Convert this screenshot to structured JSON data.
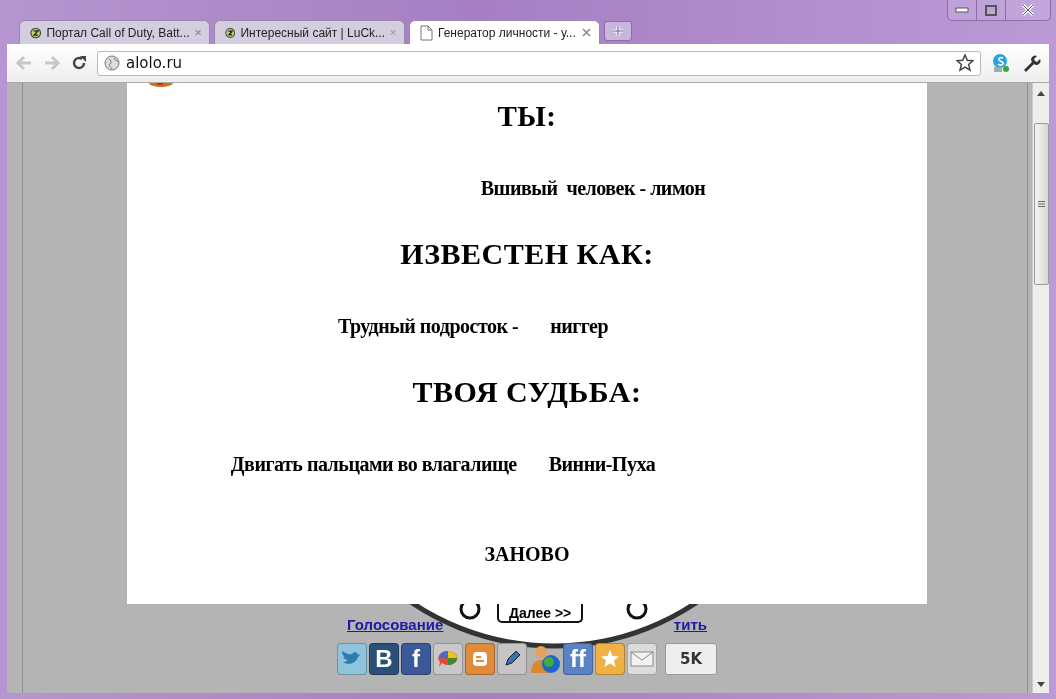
{
  "tabs": [
    {
      "title": "Портал Call of Duty, Batt...",
      "selected": false
    },
    {
      "title": "Интересный сайт | LuCk...",
      "selected": false
    },
    {
      "title": "Генератор личности - у...",
      "selected": true
    }
  ],
  "toolbar": {
    "back_disabled": true,
    "forward_disabled": true,
    "address": "alolo.ru"
  },
  "generator": {
    "sections": [
      {
        "heading": "ТЫ:",
        "parts": [
          "Вшивый  человек - лимон"
        ]
      },
      {
        "heading": "ИЗВЕСТЕН КАК:",
        "parts": [
          "Трудный подросток -",
          "ниггер"
        ]
      },
      {
        "heading": "ТВОЯ СУДЬБА:",
        "parts": [
          "Двигать пальцами во влагалище",
          "Винни-Пуха"
        ]
      }
    ],
    "restart": "ЗАНОВО"
  },
  "behind": {
    "next_button": "Далее >>",
    "link_left": "Голосование",
    "link_right": "тить"
  },
  "share": {
    "buttons": [
      {
        "kind": "twitter"
      },
      {
        "kind": "letter",
        "label": "B",
        "color": "#2b5077"
      },
      {
        "kind": "letter",
        "label": "f",
        "color": "#3b5998"
      },
      {
        "kind": "buzz"
      },
      {
        "kind": "blogger"
      },
      {
        "kind": "pencil"
      },
      {
        "kind": "people"
      },
      {
        "kind": "letter",
        "label": "ff",
        "color": "#5b82c4"
      },
      {
        "kind": "star"
      },
      {
        "kind": "mail"
      }
    ],
    "count": "5K"
  }
}
